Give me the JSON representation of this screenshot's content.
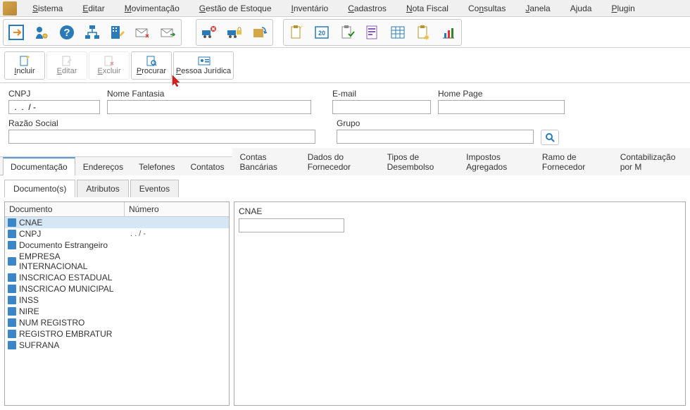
{
  "menubar": [
    {
      "label": "Sistema",
      "underline": 0
    },
    {
      "label": "Editar",
      "underline": 0
    },
    {
      "label": "Movimentação",
      "underline": 0
    },
    {
      "label": "Gestão de Estoque",
      "underline": 0
    },
    {
      "label": "Inventário",
      "underline": 0
    },
    {
      "label": "Cadastros",
      "underline": 0
    },
    {
      "label": "Nota Fiscal",
      "underline": 0
    },
    {
      "label": "Consultas",
      "underline": 2
    },
    {
      "label": "Janela",
      "underline": 0
    },
    {
      "label": "Ajuda",
      "underline": 1
    },
    {
      "label": "Plugin",
      "underline": 0
    }
  ],
  "action_buttons": [
    {
      "key": "incluir",
      "label": "Incluir",
      "enabled": true
    },
    {
      "key": "editar",
      "label": "Editar",
      "enabled": false
    },
    {
      "key": "excluir",
      "label": "Excluir",
      "enabled": false
    },
    {
      "key": "procurar",
      "label": "Procurar",
      "enabled": true
    },
    {
      "key": "pessoa",
      "label": "Pessoa Jurídica",
      "enabled": true
    }
  ],
  "form": {
    "cnpj_label": "CNPJ",
    "cnpj_value": " .  .  / - ",
    "nome_label": "Nome Fantasia",
    "nome_value": "",
    "email_label": "E-mail",
    "email_value": "",
    "home_label": "Home Page",
    "home_value": "",
    "razao_label": "Razão Social",
    "razao_value": "",
    "grupo_label": "Grupo",
    "grupo_value": ""
  },
  "main_tabs": [
    "Documentação",
    "Endereços",
    "Telefones",
    "Contatos",
    "Contas Bancárias",
    "Dados do Fornecedor",
    "Tipos de Desembolso",
    "Impostos Agregados",
    "Ramo de Fornecedor",
    "Contabilização por M"
  ],
  "main_tab_active": 0,
  "sub_tabs": [
    "Documento(s)",
    "Atributos",
    "Eventos"
  ],
  "sub_tab_active": 0,
  "doc_table": {
    "col_doc": "Documento",
    "col_num": "Número",
    "rows": [
      {
        "label": "CNAE",
        "num": "",
        "active": true
      },
      {
        "label": "CNPJ",
        "num": " .  .  / - ",
        "active": false
      },
      {
        "label": "Documento Estrangeiro",
        "num": "",
        "active": false
      },
      {
        "label": "EMPRESA INTERNACIONAL",
        "num": "",
        "active": false
      },
      {
        "label": "INSCRICAO ESTADUAL",
        "num": "",
        "active": false
      },
      {
        "label": "INSCRICAO MUNICIPAL",
        "num": "",
        "active": false
      },
      {
        "label": "INSS",
        "num": "",
        "active": false
      },
      {
        "label": "NIRE",
        "num": "",
        "active": false
      },
      {
        "label": "NUM REGISTRO",
        "num": "",
        "active": false
      },
      {
        "label": "REGISTRO EMBRATUR",
        "num": "",
        "active": false
      },
      {
        "label": "SUFRANA",
        "num": "",
        "active": false
      }
    ]
  },
  "detail": {
    "cnae_label": "CNAE",
    "cnae_value": ""
  }
}
